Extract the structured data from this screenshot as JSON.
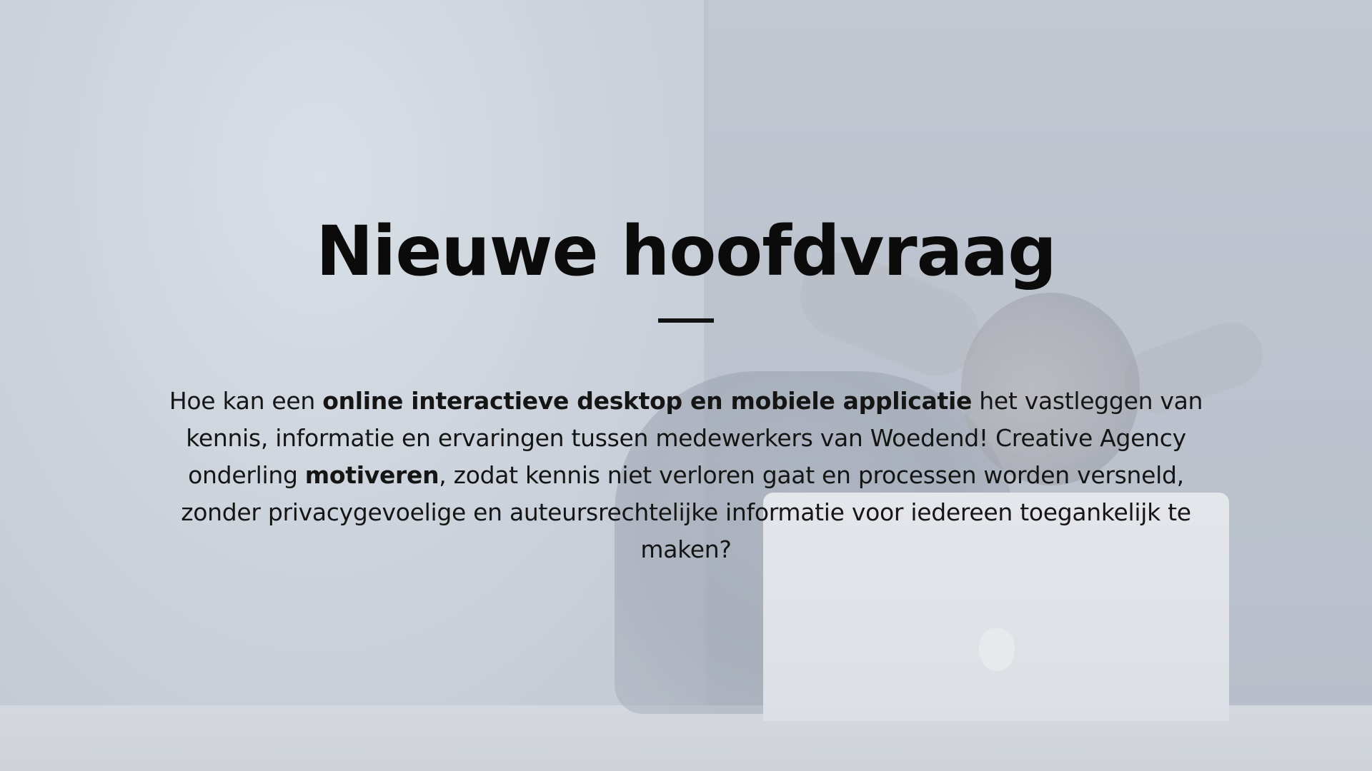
{
  "slide": {
    "title": "Nieuwe hoofdvraag",
    "question": {
      "part1": "Hoe kan een ",
      "emphasis1": "online interactieve desktop en mobiele applicatie",
      "part2": " het vastleggen van kennis, informatie en ervaringen tussen medewerkers van Woedend! Creative Agency onderling ",
      "emphasis2": "motiveren",
      "part3": ", zodat kennis niet verloren gaat en processen worden versneld, zonder privacygevoelige en auteursrechtelijke informatie voor iedereen toegankelijk te maken?"
    }
  },
  "colors": {
    "text": "#111111",
    "background": "#b3bbc6",
    "divider": "#111111"
  }
}
